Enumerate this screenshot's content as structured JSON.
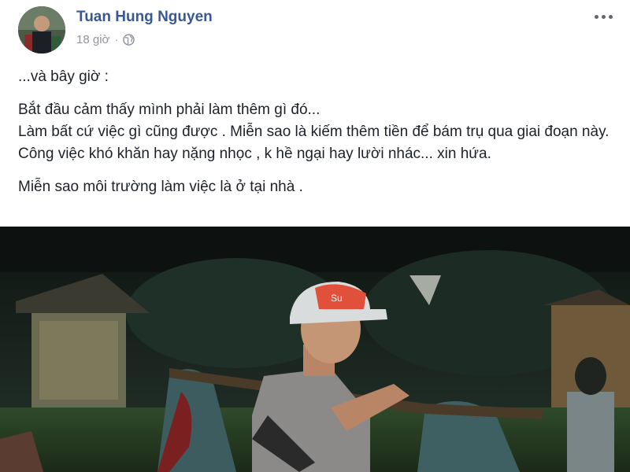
{
  "post": {
    "author": "Tuan Hung Nguyen",
    "time": "18 giờ",
    "separator": "·",
    "privacy_icon": "globe-icon",
    "more_icon": "more-options-icon",
    "paragraphs": [
      {
        "lines": [
          "...và bây giờ :"
        ]
      },
      {
        "lines": [
          "Bắt đầu cảm thấy mình phải làm thêm gì đó...",
          "Làm bất cứ việc gì cũng được . Miễn sao là kiếm thêm tiền để bám trụ qua giai đoạn này.",
          "Công việc khó khăn hay nặng nhọc , k hề ngại hay lười nhác... xin hứa."
        ]
      },
      {
        "lines": [
          "Miễn sao môi trường làm việc là ở tại nhà ."
        ]
      }
    ],
    "cap_text": "Su"
  },
  "colors": {
    "author_link": "#385898",
    "meta": "#90949c",
    "text": "#1d2129",
    "photo_bg": "#1a2420"
  }
}
